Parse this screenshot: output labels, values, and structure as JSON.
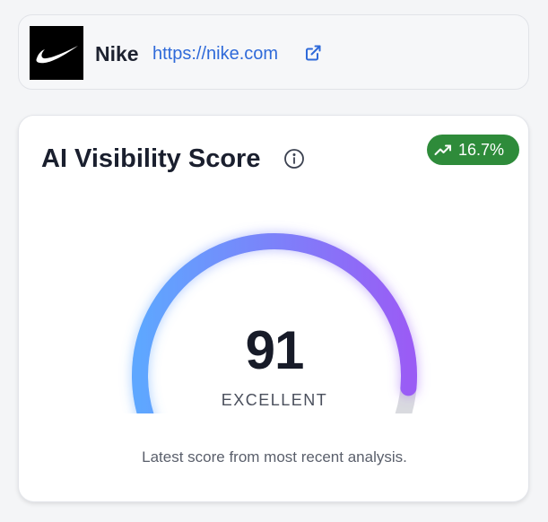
{
  "brand": {
    "logo_icon": "nike-swoosh-icon",
    "name": "Nike",
    "url": "https://nike.com",
    "external_link_icon": "external-link-icon"
  },
  "score_card": {
    "title": "AI Visibility Score",
    "info_icon": "info-icon",
    "trend": {
      "icon": "trending-up-icon",
      "value": "16.7%",
      "color": "#2e8b3a"
    },
    "gauge": {
      "score": 91,
      "max": 100,
      "gradient_start": "#5ea7ff",
      "gradient_end": "#9a5cf5",
      "track_color": "#d9dadf"
    },
    "score_text": "91",
    "rating": "EXCELLENT",
    "caption": "Latest score from most recent analysis."
  }
}
